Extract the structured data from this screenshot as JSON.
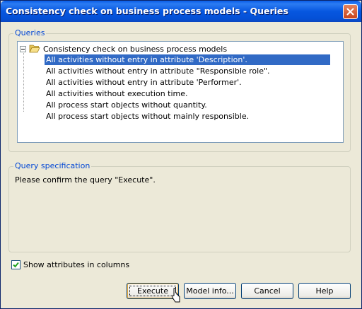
{
  "window": {
    "title": "Consistency check on business process models - Queries",
    "close_icon": "close-icon"
  },
  "queries": {
    "group_label": "Queries",
    "root_label": "Consistency check on business process models",
    "items": [
      "All activities without entry in attribute 'Description'.",
      "All activities without entry in attribute \"Responsible role\".",
      "All activities without entry in attribute 'Performer'.",
      "All activities without execution time.",
      "All process start objects without quantity.",
      "All process start objects without mainly responsible."
    ],
    "selected_index": 0
  },
  "spec": {
    "group_label": "Query specification",
    "text": "Please confirm the query \"Execute\"."
  },
  "options": {
    "show_attributes_label": "Show attributes in columns",
    "show_attributes_checked": true
  },
  "buttons": {
    "execute": "Execute",
    "model_info": "Model info...",
    "cancel": "Cancel",
    "help": "Help"
  },
  "colors": {
    "title_bar": "#0757e0",
    "selection": "#316ac5",
    "group_label": "#0046d5"
  }
}
